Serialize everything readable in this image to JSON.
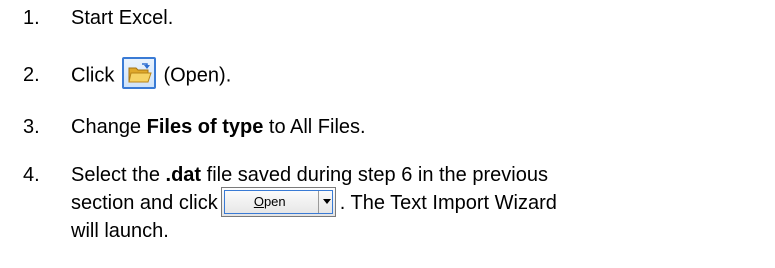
{
  "steps": [
    {
      "number": "1.",
      "text": "Start Excel."
    },
    {
      "number": "2.",
      "pre": "Click",
      "post": "(Open)."
    },
    {
      "number": "3.",
      "pre": "Change ",
      "bold": "Files of type",
      "post": " to All Files."
    },
    {
      "number": "4.",
      "line1_pre": "Select the ",
      "line1_bold": ".dat",
      "line1_post": " file saved during step 6 in the previous",
      "line2_pre": "section and click",
      "line2_post": ".  The Text Import Wizard",
      "line3": "will launch."
    }
  ],
  "open_button": {
    "label_underlined": "O",
    "label_rest": "pen"
  },
  "icons": {
    "open_toolbar": "open-folder-icon",
    "dropdown": "dropdown-arrow-icon"
  },
  "colors": {
    "button_border": "#3a7bd5",
    "folder": "#f0c43a"
  }
}
